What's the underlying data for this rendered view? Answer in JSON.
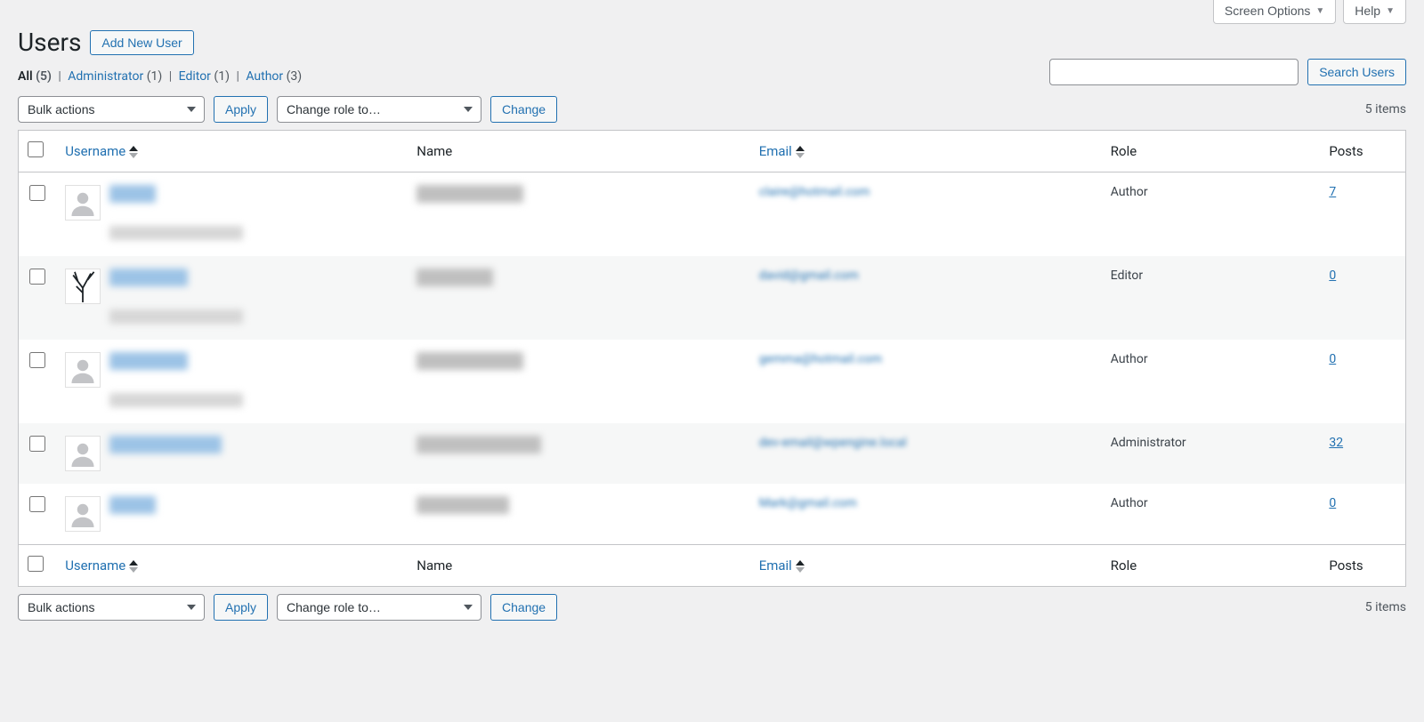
{
  "topTabs": {
    "screenOptions": "Screen Options",
    "help": "Help"
  },
  "page": {
    "title": "Users",
    "addNew": "Add New User"
  },
  "filters": {
    "all": "All",
    "allCount": "(5)",
    "admin": "Administrator",
    "adminCount": "(1)",
    "editor": "Editor",
    "editorCount": "(1)",
    "author": "Author",
    "authorCount": "(3)"
  },
  "search": {
    "button": "Search Users"
  },
  "bulk": {
    "placeholder": "Bulk actions",
    "apply": "Apply"
  },
  "roleChange": {
    "placeholder": "Change role to…",
    "change": "Change"
  },
  "itemsLabel": "5 items",
  "columns": {
    "username": "Username",
    "name": "Name",
    "email": "Email",
    "role": "Role",
    "posts": "Posts"
  },
  "rows": [
    {
      "email": "claire@hotmail.com",
      "role": "Author",
      "posts": "7",
      "avatar": "person",
      "hasActions": true,
      "uW": 52,
      "nW": 120
    },
    {
      "email": "david@gmail.com",
      "role": "Editor",
      "posts": "0",
      "avatar": "branch",
      "hasActions": true,
      "uW": 88,
      "nW": 86
    },
    {
      "email": "gemma@hotmail.com",
      "role": "Author",
      "posts": "0",
      "avatar": "person",
      "hasActions": true,
      "uW": 88,
      "nW": 120
    },
    {
      "email": "dev-email@wpengine.local",
      "role": "Administrator",
      "posts": "32",
      "avatar": "person",
      "hasActions": false,
      "uW": 126,
      "nW": 140
    },
    {
      "email": "Mark@gmail.com",
      "role": "Author",
      "posts": "0",
      "avatar": "person",
      "hasActions": false,
      "uW": 52,
      "nW": 104
    }
  ]
}
